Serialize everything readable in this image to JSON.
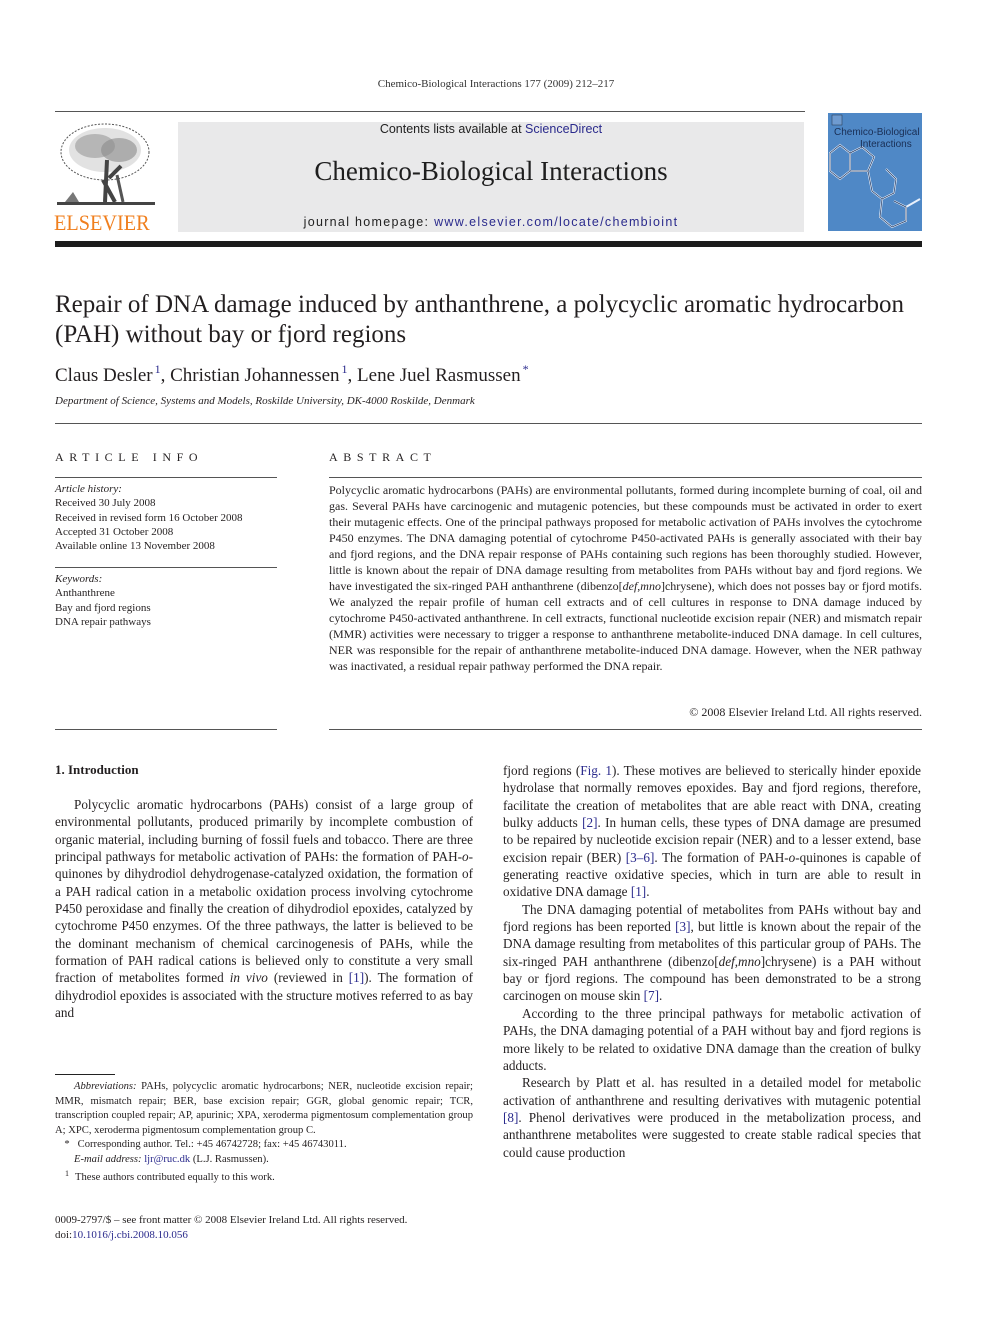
{
  "header": {
    "running_head": "Chemico-Biological Interactions 177 (2009) 212–217",
    "publisher_logo_text": "ELSEVIER",
    "contents_prefix": "Contents lists available at ",
    "contents_link": "ScienceDirect",
    "journal_title": "Chemico-Biological Interactions",
    "homepage_prefix": "journal homepage: ",
    "homepage_link": "www.elsevier.com/locate/chembioint",
    "cover_title_line1": "Chemico-Biological",
    "cover_title_line2": "Interactions",
    "colors": {
      "elsevier_orange": "#f07f1e",
      "banner_gray": "#e9e9ea",
      "cover_blue": "#4f88c6",
      "link_blue": "#2a2a8c"
    }
  },
  "article": {
    "title": "Repair of DNA damage induced by anthanthrene, a polycyclic aromatic hydrocarbon (PAH) without bay or fjord regions",
    "authors": [
      {
        "name": "Claus Desler",
        "mark": "1"
      },
      {
        "name": "Christian Johannessen",
        "mark": "1"
      },
      {
        "name": "Lene Juel Rasmussen",
        "mark": "*"
      }
    ],
    "author_separator": ", ",
    "affiliation": "Department of Science, Systems and Models, Roskilde University, DK-4000 Roskilde, Denmark"
  },
  "article_info": {
    "heading": "ARTICLE INFO",
    "history_label": "Article history:",
    "history": [
      "Received 30 July 2008",
      "Received in revised form 16 October 2008",
      "Accepted 31 October 2008",
      "Available online 13 November 2008"
    ],
    "keywords_label": "Keywords:",
    "keywords": [
      "Anthanthrene",
      "Bay and fjord regions",
      "DNA repair pathways"
    ]
  },
  "abstract": {
    "heading": "ABSTRACT",
    "part1": "Polycyclic aromatic hydrocarbons (PAHs) are environmental pollutants, formed during incomplete burning of coal, oil and gas. Several PAHs have carcinogenic and mutagenic potencies, but these compounds must be activated in order to exert their mutagenic effects. One of the principal pathways proposed for metabolic activation of PAHs involves the cytochrome P450 enzymes. The DNA damaging potential of cytochrome P450-activated PAHs is generally associated with their bay and fjord regions, and the DNA repair response of PAHs containing such regions has been thoroughly studied. However, little is known about the repair of DNA damage resulting from metabolites from PAHs without bay and fjord regions. We have investigated the six-ringed PAH anthanthrene (dibenzo[",
    "italic1": "def",
    "comma": ",",
    "italic2": "mno",
    "part2": "]chrysene), which does not posses bay or fjord motifs. We analyzed the repair profile of human cell extracts and of cell cultures in response to DNA damage induced by cytochrome P450-activated anthanthrene. In cell extracts, functional nucleotide excision repair (NER) and mismatch repair (MMR) activities were necessary to trigger a response to anthanthrene metabolite-induced DNA damage. In cell cultures, NER was responsible for the repair of anthanthrene metabolite-induced DNA damage. However, when the NER pathway was inactivated, a residual repair pathway performed the DNA repair.",
    "copyright": "© 2008 Elsevier Ireland Ltd. All rights reserved."
  },
  "introduction": {
    "heading": "1.  Introduction",
    "p1": {
      "a": "Polycyclic aromatic hydrocarbons (PAHs) consist of a large group of environmental pollutants, produced primarily by incomplete combustion of organic material, including burning of fossil fuels and tobacco. There are three principal pathways for metabolic activation of PAHs: the formation of PAH-",
      "o": "o",
      "b": "-quinones by dihydrodiol dehydrogenase-catalyzed oxidation, the formation of a PAH radical cation in a metabolic oxidation process involving cytochrome P450 peroxidase and finally the creation of dihydrodiol epoxides, catalyzed by cytochrome P450 enzymes. Of the three pathways, the latter is believed to be the dominant mechanism of chemical carcinogenesis of PAHs, while the formation of PAH radical cations is believed only to constitute a very small fraction of metabolites formed ",
      "invivo": "in vivo",
      "c": " (reviewed in ",
      "ref1": "[1]",
      "d": "). The formation of dihydrodiol epoxides is associated with the structure motives referred to as bay and"
    },
    "p1_cont": {
      "a": "fjord regions (",
      "fig": "Fig. 1",
      "b": "). These motives are believed to sterically hinder epoxide hydrolase that normally removes epoxides. Bay and fjord regions, therefore, facilitate the creation of metabolites that are able react with DNA, creating bulky adducts ",
      "ref2": "[2]",
      "c": ". In human cells, these types of DNA damage are presumed to be repaired by nucleotide excision repair (NER) and to a lesser extend, base excision repair (BER) ",
      "ref3_6": "[3–6]",
      "d": ". The formation of PAH-",
      "o": "o",
      "e": "-quinones is capable of generating reactive oxidative species, which in turn are able to result in oxidative DNA damage ",
      "ref1": "[1]",
      "f": "."
    },
    "p2": {
      "a": "The DNA damaging potential of metabolites from PAHs without bay and fjord regions has been reported ",
      "ref3": "[3]",
      "b": ", but little is known about the repair of the DNA damage resulting from metabolites of this particular group of PAHs. The six-ringed PAH anthanthrene (dibenzo[",
      "def": "def",
      "comma": ",",
      "mno": "mno",
      "c": "]chrysene) is a PAH without bay or fjord regions. The compound has been demonstrated to be a strong carcinogen on mouse skin ",
      "ref7": "[7]",
      "d": "."
    },
    "p3": "According to the three principal pathways for metabolic activation of PAHs, the DNA damaging potential of a PAH without bay and fjord regions is more likely to be related to oxidative DNA damage than the creation of bulky adducts.",
    "p4": {
      "a": "Research by Platt et al. has resulted in a detailed model for metabolic activation of anthanthrene and resulting derivatives with mutagenic potential ",
      "ref8": "[8]",
      "b": ". Phenol derivatives were produced in the metabolization process, and anthanthrene metabolites were suggested to create stable radical species that could cause production"
    }
  },
  "footnotes": {
    "abbrev_label": "Abbreviations:",
    "abbrev_text": " PAHs, polycyclic aromatic hydrocarbons; NER, nucleotide excision repair; MMR, mismatch repair; BER, base excision repair; GGR, global genomic repair; TCR, transcription coupled repair; AP, apurinic; XPA, xeroderma pigmentosum complementation group A; XPC, xeroderma pigmentosum complementation group C.",
    "corresponding_mark": "*",
    "corresponding_text": "Corresponding author. Tel.: +45 46742728; fax: +45 46743011.",
    "email_label": "E-mail address:",
    "email": "ljr@ruc.dk",
    "email_suffix": " (L.J. Rasmussen).",
    "equal_mark": "1",
    "equal_text": "These authors contributed equally to this work."
  },
  "bottom": {
    "issn_line": "0009-2797/$ – see front matter © 2008 Elsevier Ireland Ltd. All rights reserved.",
    "doi_prefix": "doi:",
    "doi": "10.1016/j.cbi.2008.10.056"
  }
}
